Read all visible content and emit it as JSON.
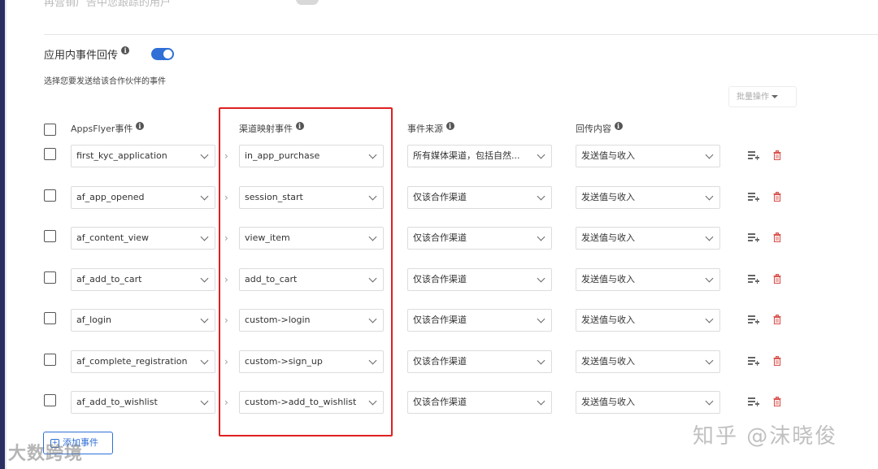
{
  "top_partial_text": "再营销广告中您跟踪的用户",
  "section": {
    "title": "应用内事件回传",
    "toggle_on": true,
    "subtitle": "选择您要发送给该合作伙伴的事件"
  },
  "bulk_action_label": "批量操作",
  "headers": {
    "appsflyer": "AppsFlyer事件",
    "mapped": "渠道映射事件",
    "source": "事件来源",
    "content": "回传内容"
  },
  "rows": [
    {
      "af_event": "first_kyc_application",
      "mapped": "in_app_purchase",
      "source": "所有媒体渠道，包括自然...",
      "content": "发送值与收入"
    },
    {
      "af_event": "af_app_opened",
      "mapped": "session_start",
      "source": "仅该合作渠道",
      "content": "发送值与收入"
    },
    {
      "af_event": "af_content_view",
      "mapped": "view_item",
      "source": "仅该合作渠道",
      "content": "发送值与收入"
    },
    {
      "af_event": "af_add_to_cart",
      "mapped": "add_to_cart",
      "source": "仅该合作渠道",
      "content": "发送值与收入"
    },
    {
      "af_event": "af_login",
      "mapped": "custom->login",
      "source": "仅该合作渠道",
      "content": "发送值与收入"
    },
    {
      "af_event": "af_complete_registration",
      "mapped": "custom->sign_up",
      "source": "仅该合作渠道",
      "content": "发送值与收入"
    },
    {
      "af_event": "af_add_to_wishlist",
      "mapped": "custom->add_to_wishlist",
      "source": "仅该合作渠道",
      "content": "发送值与收入"
    }
  ],
  "add_event_label": "添加事件",
  "watermarks": {
    "left": "大数跨境",
    "right": "知乎 @沫晓俊"
  },
  "colors": {
    "accent": "#2f6fd6",
    "highlight_box": "#e02020",
    "delete_icon": "#d9534f"
  }
}
